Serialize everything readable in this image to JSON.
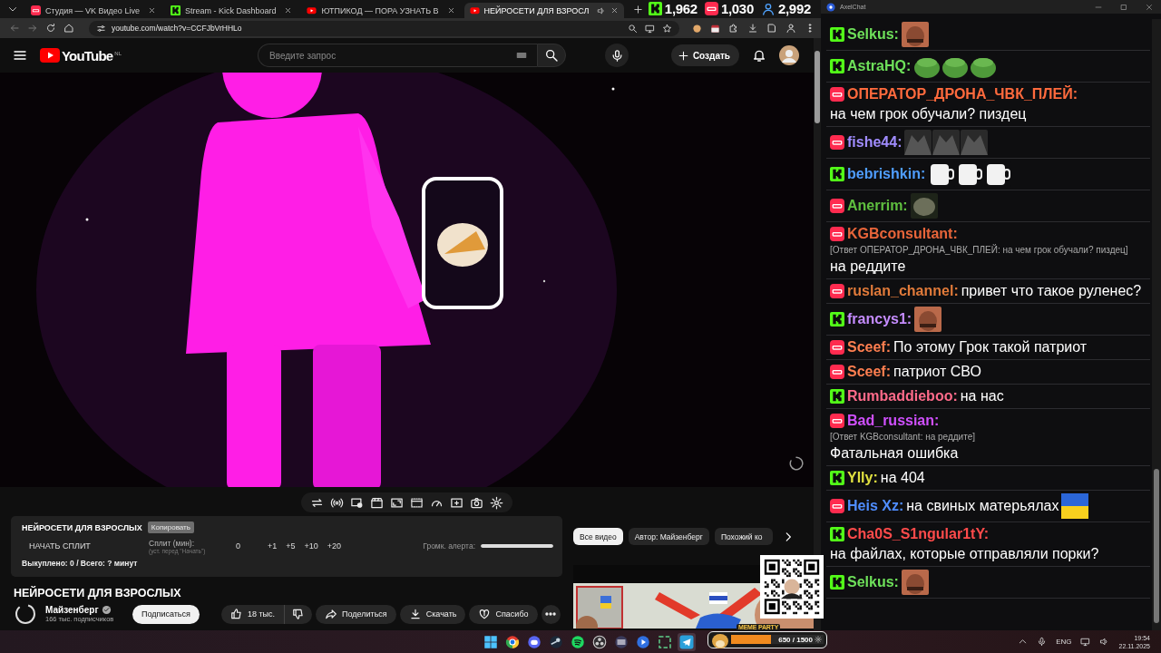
{
  "browser": {
    "tabs": [
      {
        "kind": "vk",
        "title": "Студия — VK Видео Live",
        "selected": false,
        "audio": false
      },
      {
        "kind": "kick",
        "title": "Stream - Kick Dashboard",
        "selected": false,
        "audio": false
      },
      {
        "kind": "youtube",
        "title": "ЮТПИКОД — ПОРА УЗНАТЬ В",
        "selected": false,
        "audio": false
      },
      {
        "kind": "youtube",
        "title": "НЕЙРОСЕТИ ДЛЯ ВЗРОСЛ",
        "selected": true,
        "audio": true
      }
    ],
    "url": "youtube.com/watch?v=CCFJbVrHHLo"
  },
  "stream_counters": [
    {
      "kind": "kick",
      "count": "1,962"
    },
    {
      "kind": "vk",
      "count": "1,030"
    },
    {
      "kind": "viewers",
      "count": "2,992"
    }
  ],
  "youtube": {
    "logo": "YouTube",
    "region": "NL",
    "search_placeholder": "Введите запрос",
    "create": "Создать"
  },
  "split_panel": {
    "title": "НЕЙРОСЕТИ ДЛЯ ВЗРОСЛЫХ",
    "copy_button": {
      "label": "Копировать",
      "disabled": true
    },
    "start_button": "НАЧАТЬ СПЛИТ",
    "split_label": "Сплит (мин):",
    "split_hint": "(уст. перед \"Начать\")",
    "split_value": "0",
    "increments": [
      "+1",
      "+5",
      "+10",
      "+20"
    ],
    "volume_label": "Громк. алерта:",
    "volume": {
      "level": 1
    },
    "summary": "Выкуплено: 0 / Всего: ? минут"
  },
  "video_info": {
    "title": "НЕЙРОСЕТИ ДЛЯ ВЗРОСЛЫХ",
    "channel": "Майзенберг",
    "verified": true,
    "subscribers": "166 тыс. подписчиков",
    "subscribe": "Подписаться",
    "likes": "18 тыс.",
    "actions": [
      {
        "kind": "share",
        "label": "Поделиться"
      },
      {
        "kind": "download",
        "label": "Скачать"
      },
      {
        "kind": "thanks",
        "label": "Спасибо"
      }
    ]
  },
  "chips": [
    {
      "label": "Все видео",
      "selected": true
    },
    {
      "label": "Автор: Майзенберг",
      "selected": false
    },
    {
      "label": "Похожий ко",
      "selected": false
    }
  ],
  "overlay": {
    "widget_title": "MEME PARTY",
    "progress": "650 / 1500",
    "level": 0.43
  },
  "chat": {
    "title": "AxelChat",
    "messages": [
      {
        "kind": "kick",
        "author": "Selkus:",
        "color": "#6ee05a",
        "emotes": [
          {
            "kind": "face"
          }
        ]
      },
      {
        "kind": "kick",
        "author": "AstraHQ:",
        "color": "#6ee05a",
        "emotes": [
          {
            "kind": "blob"
          },
          {
            "kind": "blob"
          },
          {
            "kind": "blob"
          }
        ]
      },
      {
        "kind": "vk",
        "author": "ОПЕРАТОР_ДРОНА_ЧВК_ПЛЕЙ:",
        "color": "#ff6a3d",
        "text": "на чем грок обучали? пиздец"
      },
      {
        "kind": "vk",
        "author": "fishe44:",
        "color": "#a08cff",
        "emotes": [
          {
            "kind": "dark"
          },
          {
            "kind": "dark"
          },
          {
            "kind": "dark"
          }
        ]
      },
      {
        "kind": "kick",
        "author": "bebrishkin:",
        "color": "#4f9dff",
        "emotes": [
          {
            "kind": "cup"
          },
          {
            "kind": "cup"
          },
          {
            "kind": "cup"
          }
        ]
      },
      {
        "kind": "vk",
        "author": "Anerrim:",
        "color": "#5fbf3f",
        "emotes": [
          {
            "kind": "rock"
          }
        ]
      },
      {
        "kind": "vk",
        "author": "KGBconsultant:",
        "color": "#e8653a",
        "reply": "[Ответ ОПЕРАТОР_ДРОНА_ЧВК_ПЛЕЙ: на чем грок обучали? пиздец]",
        "text": "на реддите"
      },
      {
        "kind": "vk",
        "author": "ruslan_channel:",
        "color": "#e07a3a",
        "text": "привет что такое руленес?"
      },
      {
        "kind": "kick",
        "author": "francys1:",
        "color": "#c58cff",
        "emotes": [
          {
            "kind": "face"
          }
        ]
      },
      {
        "kind": "vk",
        "author": "Sceef:",
        "color": "#ff7f50",
        "text": "По этому Грок такой патриот"
      },
      {
        "kind": "vk",
        "author": "Sceef:",
        "color": "#ff7f50",
        "text": "патриот СВО"
      },
      {
        "kind": "kick",
        "author": "Rumbaddieboo:",
        "color": "#ff6b8a",
        "text": "на нас"
      },
      {
        "kind": "vk",
        "author": "Bad_russian:",
        "color": "#d050ff",
        "reply": "[Ответ KGBconsultant: на реддите]",
        "text": "Фатальная ошибка"
      },
      {
        "kind": "kick",
        "author": "Ylly:",
        "color": "#e0e040",
        "text": "на 404"
      },
      {
        "kind": "vk",
        "author": "Heis Xz:",
        "color": "#4f8dff",
        "text": "на свиных матерьялах",
        "emotes": [
          {
            "kind": "flag"
          }
        ]
      },
      {
        "kind": "kick",
        "author": "Cha0S_S1ngular1tY:",
        "color": "#ff4b4b",
        "text": "на файлах, которые отправляли порки?"
      },
      {
        "kind": "kick",
        "author": "Selkus:",
        "color": "#6ee05a",
        "emotes": [
          {
            "kind": "face"
          }
        ]
      }
    ]
  },
  "taskbar": {
    "apps": [
      {
        "kind": "start",
        "selected": false
      },
      {
        "kind": "chrome",
        "selected": false
      },
      {
        "kind": "discord",
        "selected": false
      },
      {
        "kind": "steam",
        "selected": false
      },
      {
        "kind": "spotify",
        "selected": false
      },
      {
        "kind": "obs",
        "selected": false
      },
      {
        "kind": "monitor",
        "selected": false
      },
      {
        "kind": "player",
        "selected": false
      },
      {
        "kind": "capture",
        "selected": false
      },
      {
        "kind": "telegram",
        "selected": true
      }
    ],
    "language": "ENG",
    "time": "19:54",
    "date": "22.11.2025"
  }
}
